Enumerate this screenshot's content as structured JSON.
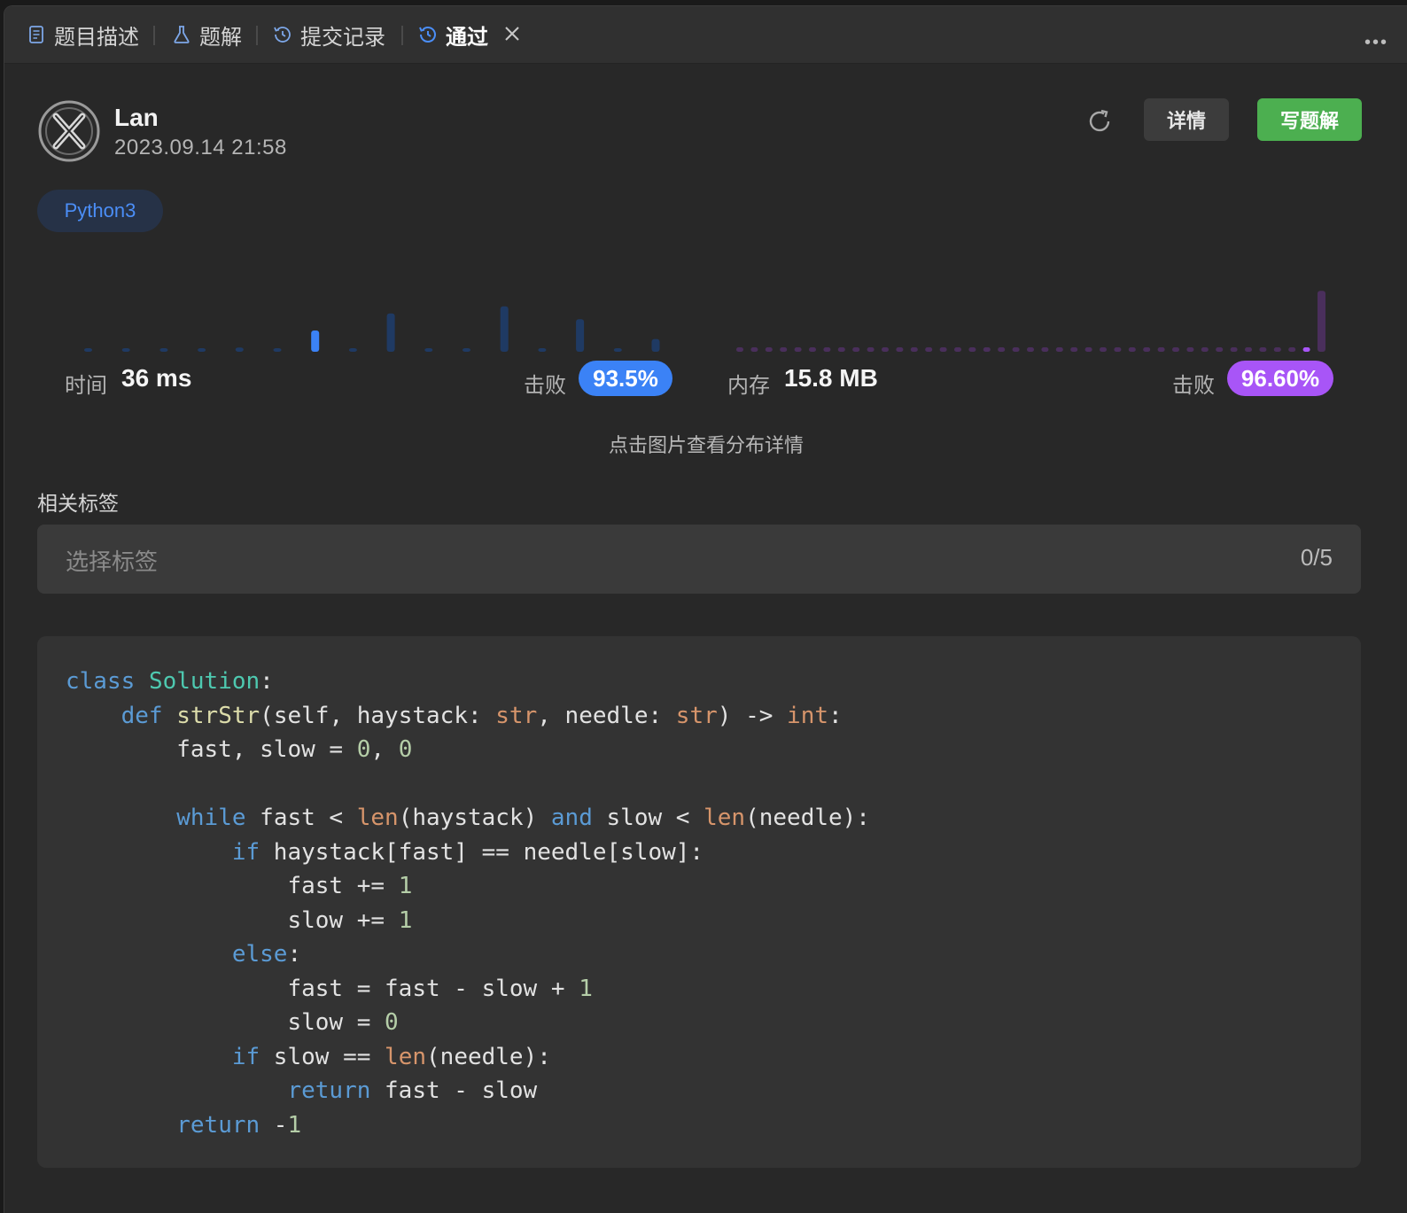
{
  "tabs": [
    {
      "label": "题目描述",
      "icon": "document-icon"
    },
    {
      "label": "题解",
      "icon": "flask-icon"
    },
    {
      "label": "提交记录",
      "icon": "history-icon"
    },
    {
      "label": "通过",
      "icon": "history-icon",
      "active": true
    }
  ],
  "submission": {
    "username": "Lan",
    "datetime": "2023.09.14 21:58",
    "language": "Python3",
    "detail_label": "详情",
    "write_solution_label": "写题解"
  },
  "runtime": {
    "label": "时间",
    "value": "36 ms",
    "beats_label": "击败",
    "beats_value": "93.5%",
    "distribution": [
      0.02,
      0.02,
      0.02,
      0.02,
      0.06,
      0.02,
      0.3,
      0.02,
      0.54,
      0.02,
      0.02,
      0.64,
      0.02,
      0.46,
      0.02,
      0.18
    ],
    "highlight_index": 6
  },
  "memory": {
    "label": "内存",
    "value": "15.8 MB",
    "beats_label": "击败",
    "beats_value": "96.60%",
    "distribution_dots": 40,
    "peak_value": 0.86
  },
  "hint": "点击图片查看分布详情",
  "tags": {
    "title": "相关标签",
    "placeholder": "选择标签",
    "count": "0/5"
  },
  "colors": {
    "accent_blue": "#3b82f6",
    "accent_purple": "#a855f7",
    "green": "#4caf50"
  },
  "code": [
    "class Solution:",
    "    def strStr(self, haystack: str, needle: str) -> int:",
    "        fast, slow = 0, 0",
    "",
    "        while fast < len(haystack) and slow < len(needle):",
    "            if haystack[fast] == needle[slow]:",
    "                fast += 1",
    "                slow += 1",
    "            else:",
    "                fast = fast - slow + 1",
    "                slow = 0",
    "            if slow == len(needle):",
    "                return fast - slow",
    "        return -1"
  ]
}
